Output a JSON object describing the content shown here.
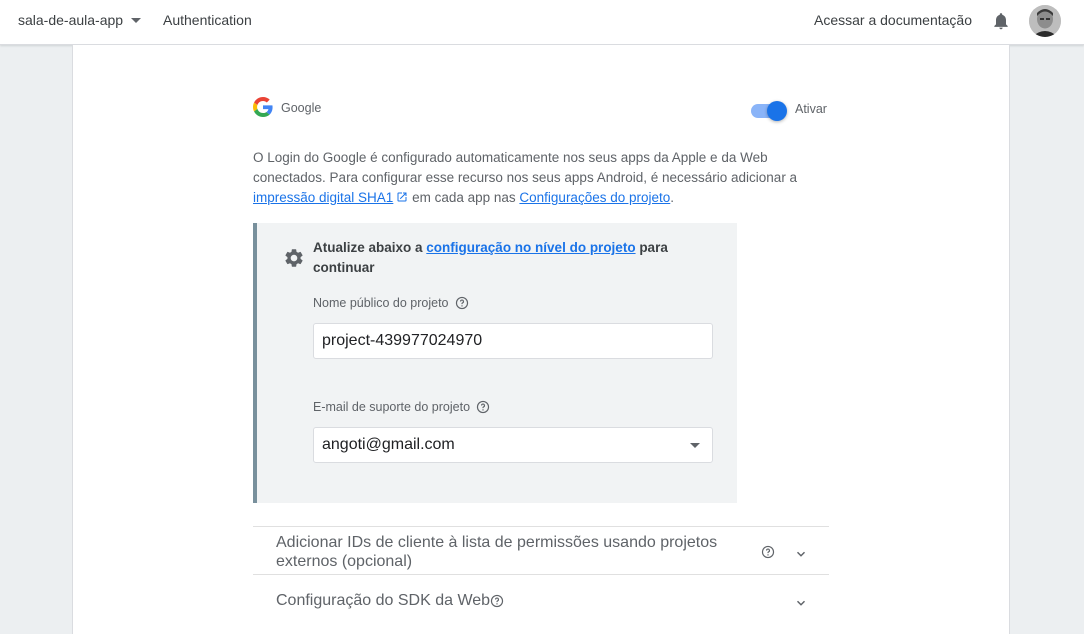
{
  "topbar": {
    "project_name": "sala-de-aula-app",
    "section": "Authentication",
    "docs_link": "Acessar a documentação"
  },
  "provider": {
    "name": "Google",
    "toggle_label": "Ativar",
    "enabled": true
  },
  "description": {
    "text1": "O Login do Google é configurado automaticamente nos seus apps da Apple e da Web conectados. Para configurar esse recurso nos seus apps Android, é necessário adicionar a ",
    "link1": "impressão digital SHA1",
    "text2": " em cada app nas ",
    "link2": "Configurações do projeto",
    "text3": "."
  },
  "info_box": {
    "title_before": "Atualize abaixo a ",
    "title_link": "configuração no nível do projeto",
    "title_after": " para continuar",
    "public_name_label": "Nome público do projeto",
    "public_name_value": "project-439977024970",
    "support_email_label": "E-mail de suporte do projeto",
    "support_email_value": "angoti@gmail.com"
  },
  "expanders": {
    "client_ids": "Adicionar IDs de cliente à lista de permissões usando projetos externos (opcional)",
    "web_sdk": "Configuração do SDK da Web"
  },
  "colors": {
    "accent": "#1a73e8",
    "toggle_track": "#8ab4f8",
    "info_border": "#78909c",
    "info_bg": "#f1f3f4"
  }
}
